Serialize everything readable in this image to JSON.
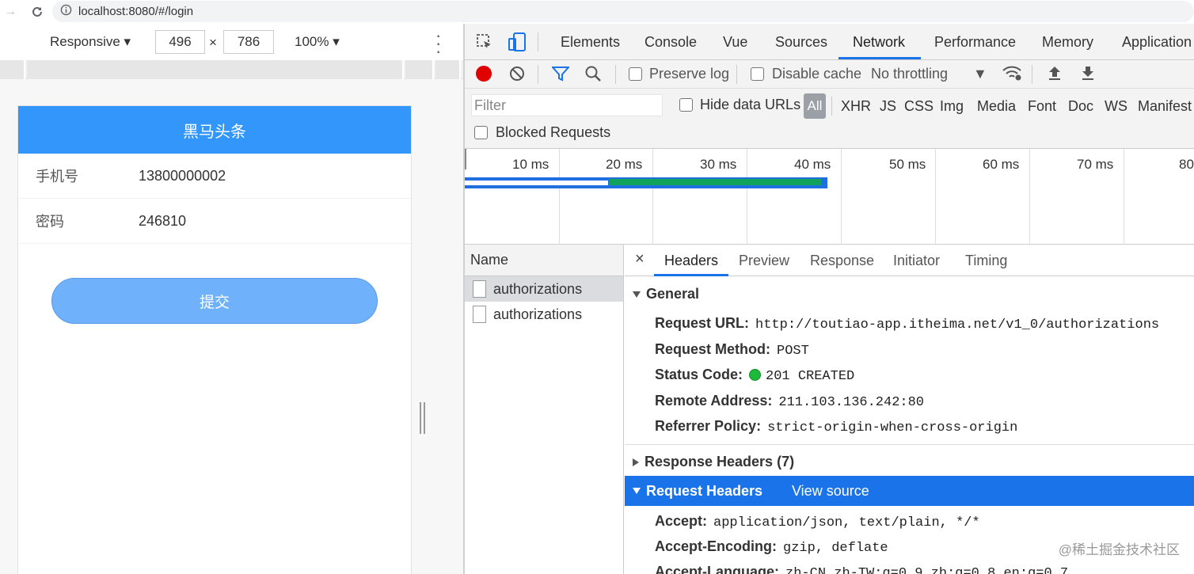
{
  "address": {
    "url": "localhost:8080/#/login"
  },
  "device_toolbar": {
    "mode": "Responsive",
    "width": "496",
    "height": "786",
    "times": "×",
    "zoom": "100%"
  },
  "app": {
    "title": "黑马头条",
    "fields": [
      {
        "label": "手机号",
        "value": "13800000002"
      },
      {
        "label": "密码",
        "value": "246810"
      }
    ],
    "submit_label": "提交"
  },
  "devtools": {
    "tabs": [
      "Elements",
      "Console",
      "Vue",
      "Sources",
      "Network",
      "Performance",
      "Memory",
      "Application"
    ],
    "active_tab": "Network",
    "toolbar": {
      "preserve_log": "Preserve log",
      "disable_cache": "Disable cache",
      "throttling": "No throttling"
    },
    "filter": {
      "placeholder": "Filter",
      "hide_data_urls": "Hide data URLs",
      "types": [
        "All",
        "XHR",
        "JS",
        "CSS",
        "Img",
        "Media",
        "Font",
        "Doc",
        "WS",
        "Manifest"
      ],
      "blocked_requests": "Blocked Requests"
    },
    "timeline": {
      "ticks": [
        "10 ms",
        "20 ms",
        "30 ms",
        "40 ms",
        "50 ms",
        "60 ms",
        "70 ms",
        "80"
      ]
    },
    "requests": {
      "header": "Name",
      "items": [
        "authorizations",
        "authorizations"
      ]
    },
    "detail": {
      "close": "×",
      "tabs": [
        "Headers",
        "Preview",
        "Response",
        "Initiator",
        "Timing"
      ],
      "general": {
        "title": "General",
        "request_url_k": "Request URL:",
        "request_url_v": "http://toutiao-app.itheima.net/v1_0/authorizations",
        "method_k": "Request Method:",
        "method_v": "POST",
        "status_k": "Status Code:",
        "status_v": "201 CREATED",
        "remote_k": "Remote Address:",
        "remote_v": "211.103.136.242:80",
        "referrer_k": "Referrer Policy:",
        "referrer_v": "strict-origin-when-cross-origin"
      },
      "response_headers": "Response Headers (7)",
      "request_headers": {
        "title": "Request Headers",
        "view_source": "View source",
        "accept_k": "Accept:",
        "accept_v": "application/json, text/plain, */*",
        "encoding_k": "Accept-Encoding:",
        "encoding_v": "gzip, deflate",
        "language_k": "Accept-Language:",
        "language_v": "zh-CN,zh-TW;q=0.9,zh;q=0.8,en;q=0.7"
      }
    }
  },
  "watermark": "@稀土掘金技术社区",
  "colors": {
    "navbar": "#3296fa",
    "submit": "#6fb2fb",
    "accent": "#1a73e8",
    "record": "#e00000"
  }
}
